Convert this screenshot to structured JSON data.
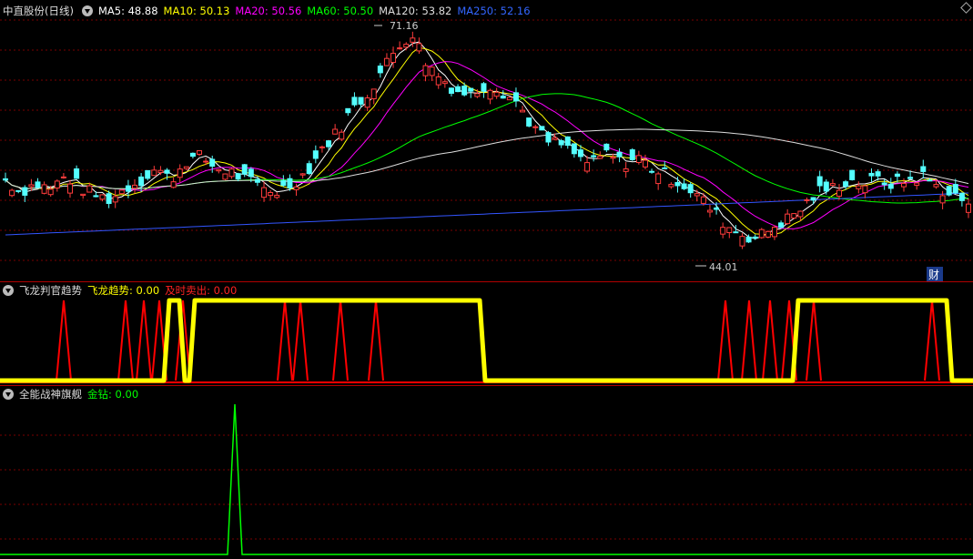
{
  "header": {
    "stock_name": "中直股份(日线)",
    "ma": [
      {
        "label": "MA5: 48.88",
        "color": "#ffffff"
      },
      {
        "label": "MA10: 50.13",
        "color": "#ffff00"
      },
      {
        "label": "MA20: 50.56",
        "color": "#ff00ff"
      },
      {
        "label": "MA60: 50.50",
        "color": "#00ff00"
      },
      {
        "label": "MA120: 53.82",
        "color": "#dddddd"
      },
      {
        "label": "MA250: 52.16",
        "color": "#3355ff"
      }
    ]
  },
  "indicator1": {
    "name": "飞龙判官趋势",
    "trend_label": "飞龙趋势: 0.00",
    "sell_label": "及时卖出: 0.00"
  },
  "indicator2": {
    "name": "全能战神旗舰",
    "signal_label": "金钻: 0.00"
  },
  "annotations": {
    "high": "71.16",
    "low": "44.01",
    "marker": "财"
  },
  "chart_data": [
    {
      "type": "candlestick",
      "title": "中直股份(日线)",
      "ylim": [
        40,
        74
      ],
      "high_marker": 71.16,
      "low_marker": 44.01,
      "ohlc_segments_close": [
        52.0,
        50.5,
        51.5,
        50.8,
        52.5,
        51.0,
        50.0,
        49.5,
        51.0,
        52.0,
        53.5,
        52.0,
        54.5,
        55.0,
        53.5,
        53.0,
        52.0,
        51.0,
        50.5,
        51.5,
        53.0,
        56.0,
        58.0,
        61.0,
        63.0,
        66.0,
        69.0,
        71.0,
        67.0,
        65.0,
        63.5,
        63.0,
        64.5,
        63.5,
        62.0,
        59.0,
        57.0,
        56.5,
        55.0,
        54.0,
        55.5,
        54.0,
        55.0,
        53.5,
        52.5,
        51.5,
        50.0,
        48.0,
        46.0,
        45.0,
        44.5,
        46.0,
        47.0,
        48.5,
        50.5,
        51.0,
        52.0,
        51.5,
        52.0,
        51.5,
        52.0,
        52.5,
        51.0,
        50.0,
        49.0
      ],
      "series": [
        {
          "name": "MA5",
          "color": "#ffffff",
          "last": 48.88
        },
        {
          "name": "MA10",
          "color": "#ffff00",
          "last": 50.13
        },
        {
          "name": "MA20",
          "color": "#ff00ff",
          "last": 50.56
        },
        {
          "name": "MA60",
          "color": "#00ff00",
          "last": 50.5
        },
        {
          "name": "MA120",
          "color": "#dddddd",
          "last": 53.82
        },
        {
          "name": "MA250",
          "color": "#3355ff",
          "last": 52.16
        }
      ]
    },
    {
      "type": "line",
      "title": "飞龙判官趋势",
      "series": [
        {
          "name": "飞龙趋势",
          "color": "#ffff00",
          "segments_high": [
            [
              186,
              197
            ],
            [
              214,
              527
            ],
            [
              877,
              1040
            ]
          ]
        },
        {
          "name": "及时卖出",
          "color": "#ff0000",
          "spikes_x": [
            70,
            138,
            158,
            175,
            201,
            313,
            330,
            374,
            413,
            797,
            823,
            846,
            867,
            894,
            1024
          ]
        }
      ]
    },
    {
      "type": "line",
      "title": "全能战神旗舰",
      "series": [
        {
          "name": "金钻",
          "color": "#00ff00",
          "spikes_x": [
            258
          ]
        }
      ]
    }
  ]
}
